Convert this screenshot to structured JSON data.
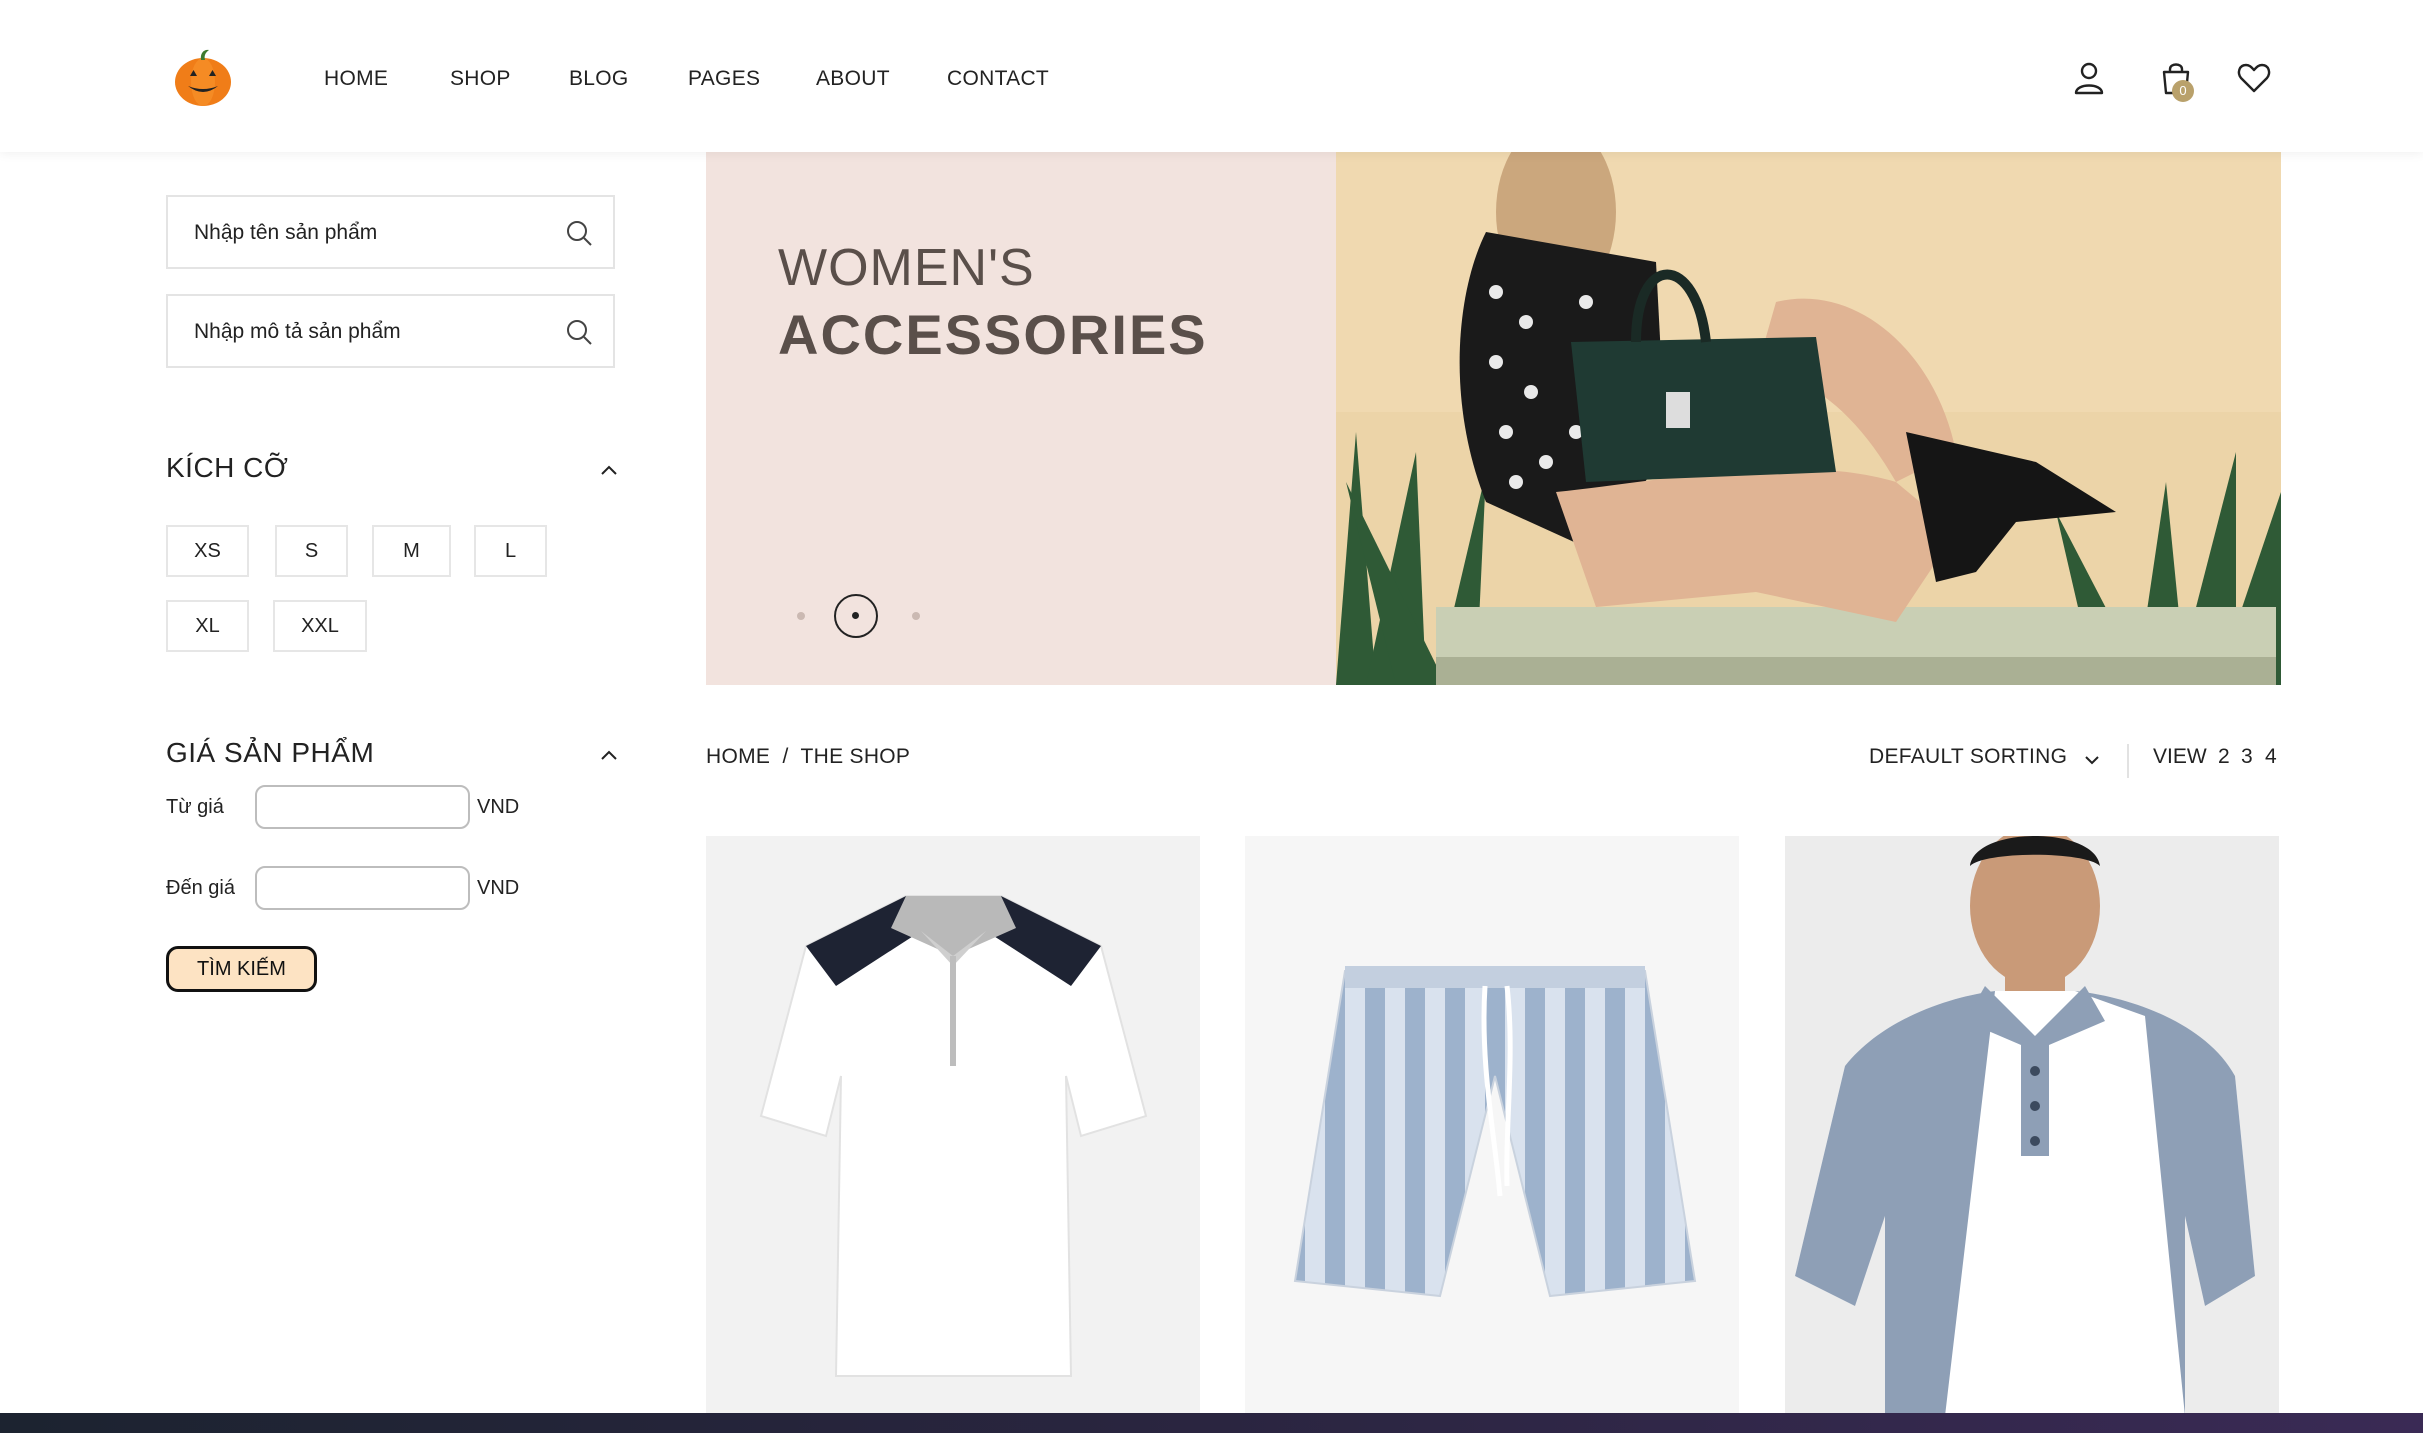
{
  "header": {
    "logo": "pumpkin-logo",
    "nav": [
      "HOME",
      "SHOP",
      "BLOG",
      "PAGES",
      "ABOUT",
      "CONTACT"
    ],
    "icons": [
      "user-icon",
      "cart-icon",
      "heart-icon"
    ],
    "cart_count": "0"
  },
  "sidebar": {
    "search_name_placeholder": "Nhập tên sản phẩm",
    "search_desc_placeholder": "Nhập mô tả sản phẩm",
    "size_title": "KÍCH CỠ",
    "sizes": [
      "XS",
      "S",
      "M",
      "L",
      "XL",
      "XXL"
    ],
    "price_title": "GIÁ SẢN PHẨM",
    "from_label": "Từ giá",
    "to_label": "Đến giá",
    "currency": "VND",
    "search_button": "TÌM KIẾM"
  },
  "banner": {
    "line1": "WOMEN'S",
    "line2": "ACCESSORIES",
    "slides": 3,
    "active_slide": 2
  },
  "toolbar": {
    "breadcrumb": "HOME  /  THE SHOP",
    "sorting": "DEFAULT SORTING",
    "view_label": "VIEW",
    "view_options": [
      "2",
      "3",
      "4"
    ]
  },
  "colors": {
    "banner_bg": "#f2e3de",
    "accent_gold": "#b9a16b",
    "search_button_bg": "#fde3c3"
  }
}
